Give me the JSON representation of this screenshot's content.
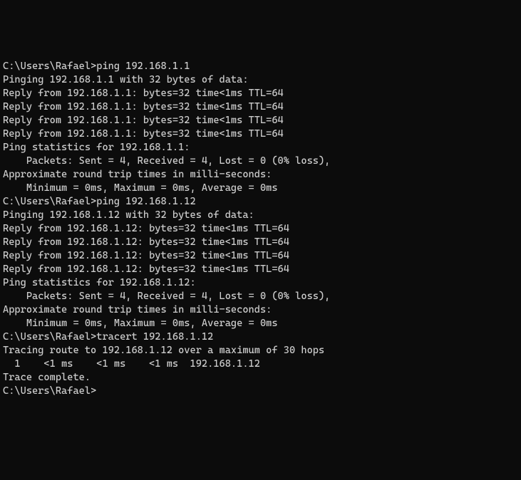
{
  "prompt": "C:\\Users\\Rafael>",
  "sessions": [
    {
      "command": "ping 192.168.1.1",
      "lines": [
        "",
        "Pinging 192.168.1.1 with 32 bytes of data:",
        "Reply from 192.168.1.1: bytes=32 time<1ms TTL=64",
        "Reply from 192.168.1.1: bytes=32 time<1ms TTL=64",
        "Reply from 192.168.1.1: bytes=32 time<1ms TTL=64",
        "Reply from 192.168.1.1: bytes=32 time<1ms TTL=64",
        "",
        "Ping statistics for 192.168.1.1:",
        "    Packets: Sent = 4, Received = 4, Lost = 0 (0% loss),",
        "Approximate round trip times in milli-seconds:",
        "    Minimum = 0ms, Maximum = 0ms, Average = 0ms",
        ""
      ]
    },
    {
      "command": "ping 192.168.1.12",
      "lines": [
        "",
        "Pinging 192.168.1.12 with 32 bytes of data:",
        "Reply from 192.168.1.12: bytes=32 time<1ms TTL=64",
        "Reply from 192.168.1.12: bytes=32 time<1ms TTL=64",
        "Reply from 192.168.1.12: bytes=32 time<1ms TTL=64",
        "Reply from 192.168.1.12: bytes=32 time<1ms TTL=64",
        "",
        "Ping statistics for 192.168.1.12:",
        "    Packets: Sent = 4, Received = 4, Lost = 0 (0% loss),",
        "Approximate round trip times in milli-seconds:",
        "    Minimum = 0ms, Maximum = 0ms, Average = 0ms",
        ""
      ]
    },
    {
      "command": "tracert 192.168.1.12",
      "lines": [
        "",
        "Tracing route to 192.168.1.12 over a maximum of 30 hops",
        "",
        "  1    <1 ms    <1 ms    <1 ms  192.168.1.12",
        "",
        "Trace complete.",
        ""
      ]
    }
  ]
}
